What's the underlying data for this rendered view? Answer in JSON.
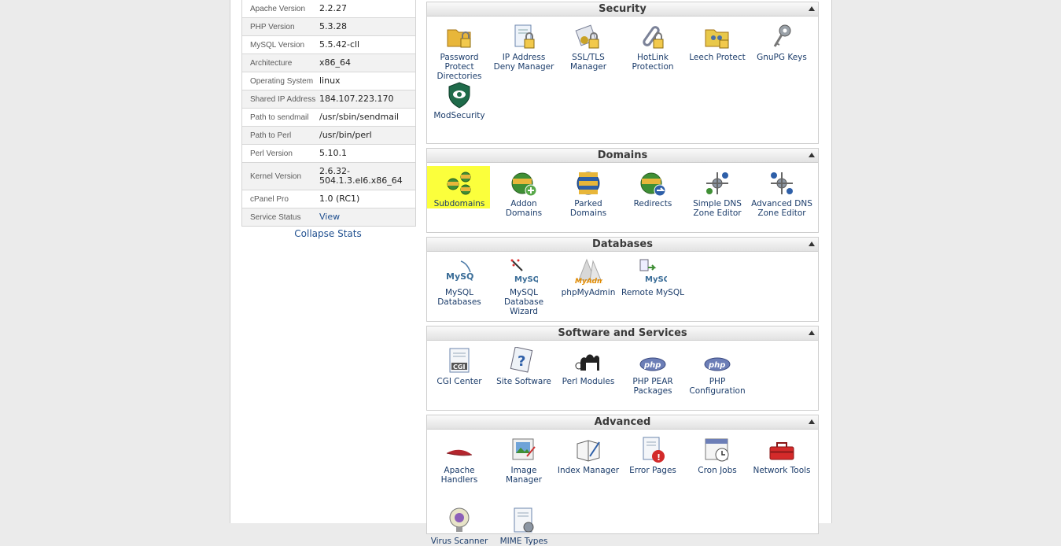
{
  "stats": [
    {
      "label": "Apache Version",
      "value": "2.2.27"
    },
    {
      "label": "PHP Version",
      "value": "5.3.28"
    },
    {
      "label": "MySQL Version",
      "value": "5.5.42-cll"
    },
    {
      "label": "Architecture",
      "value": "x86_64"
    },
    {
      "label": "Operating System",
      "value": "linux"
    },
    {
      "label": "Shared IP Address",
      "value": "184.107.223.170"
    },
    {
      "label": "Path to sendmail",
      "value": "/usr/sbin/sendmail"
    },
    {
      "label": "Path to Perl",
      "value": "/usr/bin/perl"
    },
    {
      "label": "Perl Version",
      "value": "5.10.1"
    },
    {
      "label": "Kernel Version",
      "value": "2.6.32-\n504.1.3.el6.x86_64"
    },
    {
      "label": "cPanel Pro",
      "value": "1.0 (RC1)"
    },
    {
      "label": "Service Status",
      "value": "View"
    }
  ],
  "collapse_stats": "Collapse Stats",
  "panels": {
    "security": {
      "title": "Security",
      "items": [
        {
          "label": "Password Protect Directories",
          "icon": "folder-lock-icon"
        },
        {
          "label": "IP Address Deny Manager",
          "icon": "document-lock-icon"
        },
        {
          "label": "SSL/TLS Manager",
          "icon": "certificate-lock-icon"
        },
        {
          "label": "HotLink Protection",
          "icon": "chain-lock-icon"
        },
        {
          "label": "Leech Protect",
          "icon": "folder-people-icon"
        },
        {
          "label": "GnuPG Keys",
          "icon": "keys-icon"
        },
        {
          "label": "ModSecurity",
          "icon": "shield-eye-icon"
        }
      ]
    },
    "domains": {
      "title": "Domains",
      "items": [
        {
          "label": "Subdomains",
          "icon": "www-globes-icon"
        },
        {
          "label": "Addon Domains",
          "icon": "www-add-icon"
        },
        {
          "label": "Parked Domains",
          "icon": "www-stack-icon"
        },
        {
          "label": "Redirects",
          "icon": "www-redirect-icon"
        },
        {
          "label": "Simple DNS Zone Editor",
          "icon": "dns-network-icon"
        },
        {
          "label": "Advanced DNS Zone Editor",
          "icon": "dns-advanced-icon"
        }
      ]
    },
    "databases": {
      "title": "Databases",
      "items": [
        {
          "label": "MySQL Databases",
          "icon": "mysql-icon",
          "logo": "MySQL"
        },
        {
          "label": "MySQL Database Wizard",
          "icon": "mysql-wizard-icon",
          "logo": "MySQL"
        },
        {
          "label": "phpMyAdmin",
          "icon": "phpmyadmin-icon",
          "logo": "MyAdmin"
        },
        {
          "label": "Remote MySQL",
          "icon": "remote-mysql-icon",
          "logo": "MySQL"
        }
      ]
    },
    "software": {
      "title": "Software and Services",
      "items": [
        {
          "label": "CGI Center",
          "icon": "cgi-icon",
          "logo": "CGI"
        },
        {
          "label": "Site Software",
          "icon": "site-software-icon"
        },
        {
          "label": "Perl Modules",
          "icon": "camel-icon"
        },
        {
          "label": "PHP PEAR Packages",
          "icon": "php-icon",
          "logo": "php"
        },
        {
          "label": "PHP Configuration",
          "icon": "php-config-icon",
          "logo": "php"
        }
      ]
    },
    "advanced": {
      "title": "Advanced",
      "items": [
        {
          "label": "Apache Handlers",
          "icon": "feather-icon"
        },
        {
          "label": "Image Manager",
          "icon": "image-manager-icon"
        },
        {
          "label": "Index Manager",
          "icon": "index-book-icon"
        },
        {
          "label": "Error Pages",
          "icon": "error-page-icon"
        },
        {
          "label": "Cron Jobs",
          "icon": "calendar-clock-icon"
        },
        {
          "label": "Network Tools",
          "icon": "toolbox-icon"
        },
        {
          "label": "Virus Scanner",
          "icon": "virus-scanner-icon"
        },
        {
          "label": "MIME Types",
          "icon": "mime-types-icon"
        }
      ]
    }
  }
}
